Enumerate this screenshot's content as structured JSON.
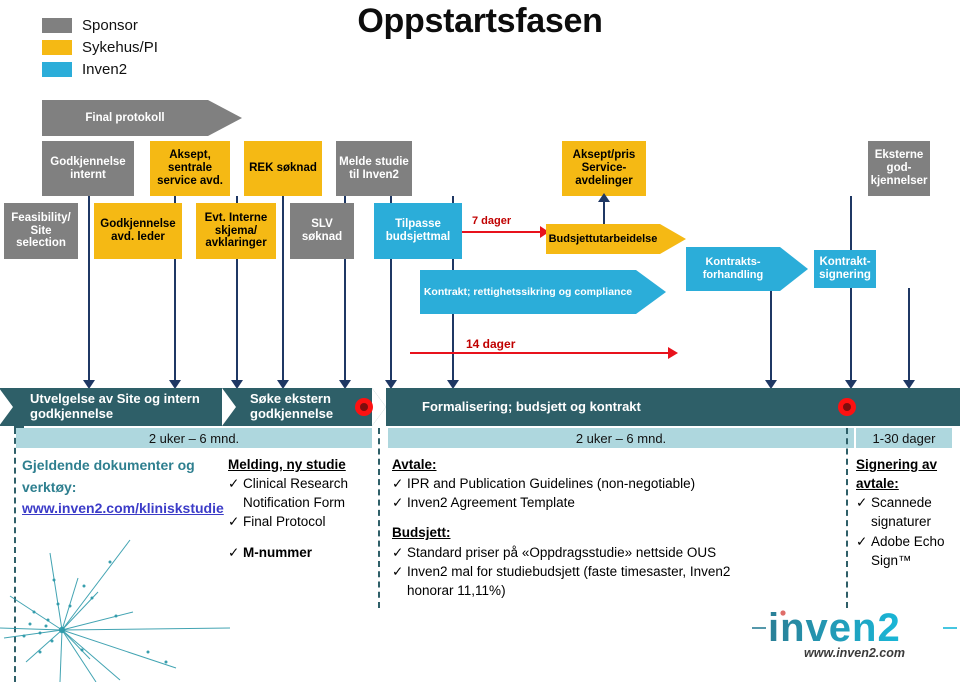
{
  "title": "Oppstartsfasen",
  "colors": {
    "sponsor": "#808080",
    "hospital": "#f5b914",
    "inven2": "#2badd9",
    "banner": "#2e5f68",
    "duration": "#aed7de",
    "connector": "#1f3864",
    "red": "#e8121c"
  },
  "legend": {
    "items": [
      {
        "label": "Sponsor",
        "color": "#808080"
      },
      {
        "label": "Sykehus/PI",
        "color": "#f5b914"
      },
      {
        "label": "Inven2",
        "color": "#2badd9"
      }
    ]
  },
  "final_protocol_arrow": {
    "label": "Final protokoll"
  },
  "row_top": [
    {
      "label": "Godkjennelse internt",
      "owner": "sponsor"
    },
    {
      "label": "Aksept, sentrale service avd.",
      "owner": "hospital"
    },
    {
      "label": "REK søknad",
      "owner": "hospital"
    },
    {
      "label": "Melde studie til Inven2",
      "owner": "sponsor"
    },
    {
      "label": "Aksept/pris Service-avdelinger",
      "owner": "hospital"
    },
    {
      "label": "Eksterne god-kjennelser",
      "owner": "sponsor"
    }
  ],
  "row_mid": [
    {
      "label": "Feasibility/ Site selection",
      "owner": "sponsor"
    },
    {
      "label": "Godkjennelse avd. leder",
      "owner": "hospital"
    },
    {
      "label": "Evt. Interne skjema/ avklaringer",
      "owner": "hospital"
    },
    {
      "label": "SLV søknad",
      "owner": "sponsor"
    },
    {
      "label": "Tilpasse budsjettmal",
      "owner": "inven2"
    },
    {
      "label": "Kontrakts-forhandling",
      "owner": "inven2"
    },
    {
      "label": "Kontrakt-signering",
      "owner": "inven2"
    }
  ],
  "arrows": {
    "budget": {
      "label": "Budsjettutarbeidelse",
      "owner": "hospital"
    },
    "contract": {
      "label": "Kontrakt; rettighetssikring og compliance",
      "owner": "inven2"
    }
  },
  "measures": [
    {
      "label": "7 dager"
    },
    {
      "label": "14 dager"
    }
  ],
  "phases": [
    {
      "label": "Utvelgelse av Site og intern godkjennelse",
      "milestone": false
    },
    {
      "label": "Søke ekstern godkjennelse",
      "milestone": true
    },
    {
      "label": "Formalisering; budsjett og kontrakt",
      "milestone": true
    }
  ],
  "durations": [
    {
      "label": "2 uker – 6 mnd."
    },
    {
      "label": "2 uker – 6 mnd."
    },
    {
      "label": "1-30 dager"
    }
  ],
  "columns": [
    {
      "heading": "Gjeldende dokumenter og verktøy:",
      "link": "www.inven2.com/kliniskstudie"
    },
    {
      "heading": "Melding, ny studie",
      "items": [
        "Clinical Research Notification  Form",
        "Final Protocol"
      ],
      "items2": [
        "M-nummer"
      ]
    },
    {
      "heading": "Avtale:",
      "items": [
        "IPR and Publication Guidelines (non-negotiable)",
        "Inven2 Agreement Template"
      ],
      "heading2": "Budsjett:",
      "items2": [
        "Standard priser på «Oppdragsstudie» nettside OUS",
        "Inven2 mal for studiebudsjett (faste timesaster, Inven2 honorar 11,11%)"
      ]
    },
    {
      "heading": "Signering av avtale:",
      "items": [
        "Scannede signaturer",
        "Adobe Echo Sign™"
      ]
    }
  ],
  "logo": {
    "name": "inven2",
    "url": "www.inven2.com"
  },
  "icons": {
    "check": "✓"
  }
}
